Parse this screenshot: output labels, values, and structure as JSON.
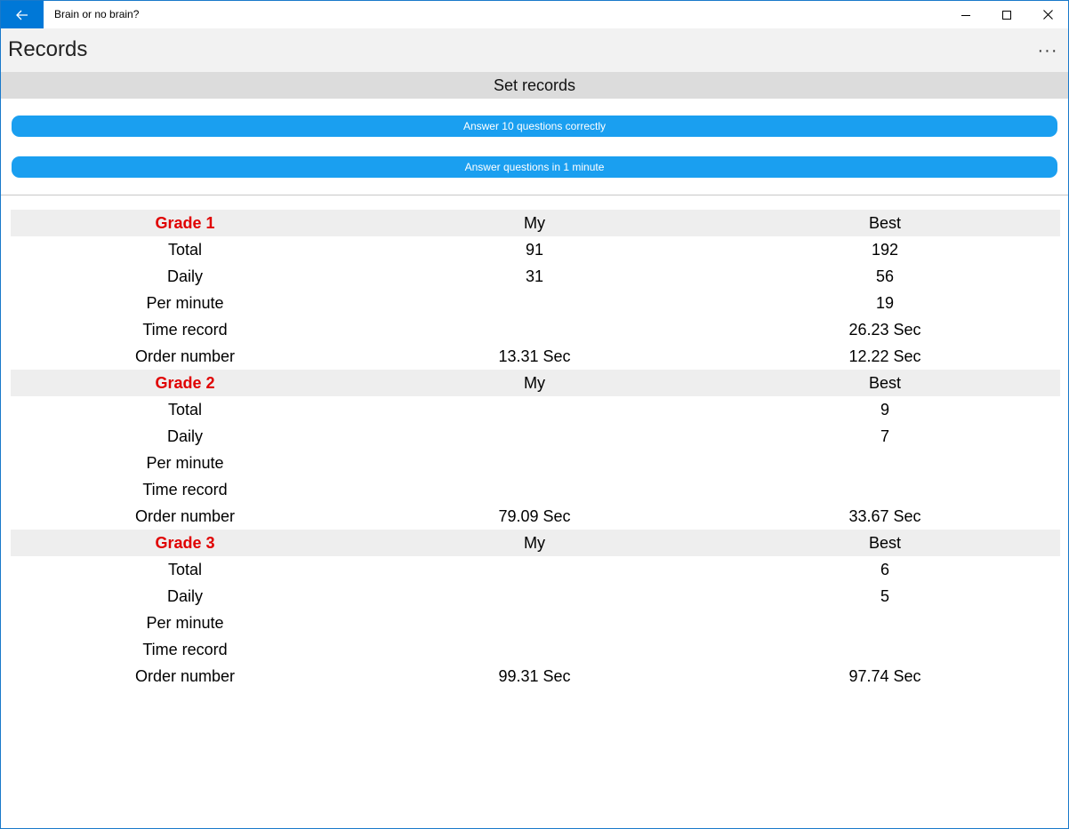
{
  "window": {
    "title": "Brain or no brain?"
  },
  "header": {
    "title": "Records",
    "more_label": "···"
  },
  "section": {
    "title": "Set records"
  },
  "actions": [
    {
      "label": "Answer 10 questions correctly"
    },
    {
      "label": "Answer questions in 1 minute"
    }
  ],
  "colors": {
    "accent": "#0078d7",
    "button": "#1a9ff0",
    "grade": "#e00000"
  },
  "grades": [
    {
      "name": "Grade 1",
      "col_my": "My",
      "col_best": "Best",
      "rows": [
        {
          "label": "Total",
          "my": "91",
          "best": "192"
        },
        {
          "label": "Daily",
          "my": "31",
          "best": "56"
        },
        {
          "label": "Per minute",
          "my": "",
          "best": "19"
        },
        {
          "label": "Time record",
          "my": "",
          "best": "26.23 Sec"
        },
        {
          "label": "Order number",
          "my": "13.31 Sec",
          "best": "12.22 Sec"
        }
      ]
    },
    {
      "name": "Grade 2",
      "col_my": "My",
      "col_best": "Best",
      "rows": [
        {
          "label": "Total",
          "my": "",
          "best": "9"
        },
        {
          "label": "Daily",
          "my": "",
          "best": "7"
        },
        {
          "label": "Per minute",
          "my": "",
          "best": ""
        },
        {
          "label": "Time record",
          "my": "",
          "best": ""
        },
        {
          "label": "Order number",
          "my": "79.09 Sec",
          "best": "33.67 Sec"
        }
      ]
    },
    {
      "name": "Grade 3",
      "col_my": "My",
      "col_best": "Best",
      "rows": [
        {
          "label": "Total",
          "my": "",
          "best": "6"
        },
        {
          "label": "Daily",
          "my": "",
          "best": "5"
        },
        {
          "label": "Per minute",
          "my": "",
          "best": ""
        },
        {
          "label": "Time record",
          "my": "",
          "best": ""
        },
        {
          "label": "Order number",
          "my": "99.31 Sec",
          "best": "97.74 Sec"
        }
      ]
    }
  ]
}
